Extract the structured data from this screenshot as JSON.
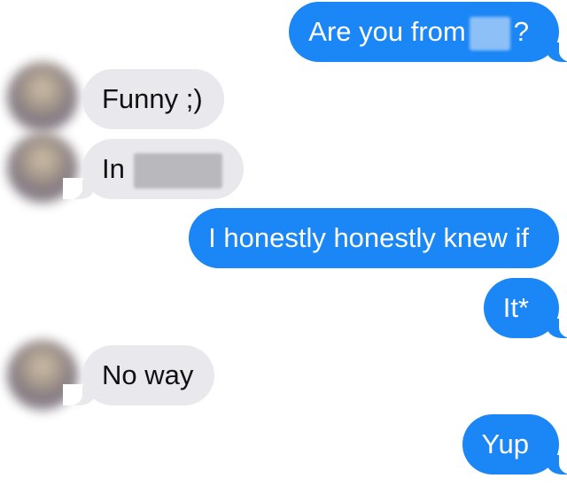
{
  "messages": [
    {
      "id": "m1",
      "direction": "sent",
      "text": "Are you from",
      "suffix": "?",
      "redacted": true
    },
    {
      "id": "m2",
      "direction": "received",
      "text": "Funny ;)"
    },
    {
      "id": "m3",
      "direction": "received",
      "text": "In",
      "redacted": true
    },
    {
      "id": "m4",
      "direction": "sent",
      "text": "I honestly honestly knew if"
    },
    {
      "id": "m5",
      "direction": "sent",
      "text": "It*"
    },
    {
      "id": "m6",
      "direction": "received",
      "text": "No way"
    },
    {
      "id": "m7",
      "direction": "sent",
      "text": "Yup"
    }
  ],
  "colors": {
    "sent_bubble": "#1b86f5",
    "received_bubble": "#e8e8ed",
    "background": "#ffffff"
  }
}
